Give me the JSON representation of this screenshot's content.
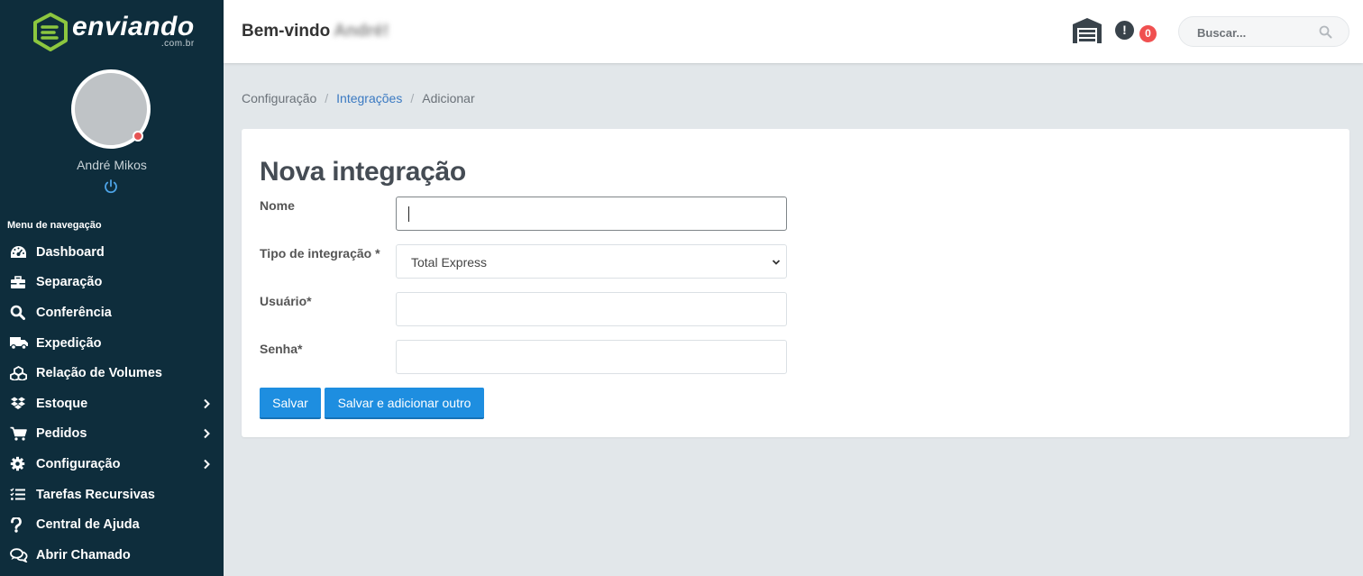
{
  "brand": {
    "name": "enviando",
    "domain": ".com.br",
    "color": "#8cc63f"
  },
  "sidebar": {
    "user_name": "André Mikos",
    "menu_heading": "Menu de navegação",
    "items": [
      {
        "label": "Dashboard",
        "icon": "gauge-icon",
        "has_children": false
      },
      {
        "label": "Separação",
        "icon": "toolbox-icon",
        "has_children": false
      },
      {
        "label": "Conferência",
        "icon": "search-icon",
        "has_children": false
      },
      {
        "label": "Expedição",
        "icon": "truck-icon",
        "has_children": false
      },
      {
        "label": "Relação de Volumes",
        "icon": "boxes-icon",
        "has_children": false
      },
      {
        "label": "Estoque",
        "icon": "dropbox-icon",
        "has_children": true
      },
      {
        "label": "Pedidos",
        "icon": "cart-icon",
        "has_children": true
      },
      {
        "label": "Configuração",
        "icon": "gear-icon",
        "has_children": true
      },
      {
        "label": "Tarefas Recursivas",
        "icon": "tasks-icon",
        "has_children": false
      },
      {
        "label": "Central de Ajuda",
        "icon": "question-icon",
        "has_children": false
      },
      {
        "label": "Abrir Chamado",
        "icon": "chat-icon",
        "has_children": false
      }
    ]
  },
  "header": {
    "welcome": "Bem-vindo",
    "welcome_name": "André!",
    "alert_symbol": "!",
    "alert_count": "0",
    "search_placeholder": "Buscar..."
  },
  "breadcrumb": {
    "items": [
      "Configuração",
      "Integrações",
      "Adicionar"
    ],
    "separator": "/"
  },
  "form": {
    "title": "Nova integração",
    "fields": {
      "nome": {
        "label": "Nome",
        "value": ""
      },
      "tipo": {
        "label": "Tipo de integração *",
        "value": "Total Express"
      },
      "usuario": {
        "label": "Usuário*",
        "value": ""
      },
      "senha": {
        "label": "Senha*",
        "value": ""
      }
    },
    "save_label": "Salvar",
    "save_add_label": "Salvar e adicionar outro"
  },
  "colors": {
    "sidebar_bg": "#0e2d3c",
    "primary_button": "#1e8ee0",
    "link": "#3b7ac2",
    "badge": "#f05050"
  }
}
